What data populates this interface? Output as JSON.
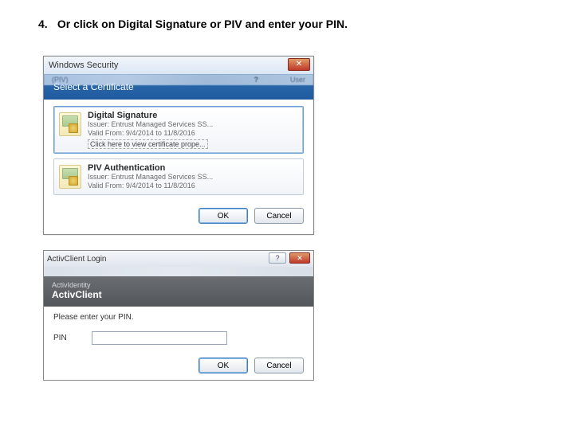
{
  "instruction": {
    "number": "4.",
    "text": "Or click on Digital Signature or PIV and enter your PIN."
  },
  "dlg1": {
    "title": "Windows Security",
    "blurred_tab": "(PIV)",
    "blurred_mark": "?",
    "blurred_user": "User",
    "header": "Select a Certificate",
    "cert1": {
      "name": "Digital Signature",
      "issuer": "Issuer: Entrust Managed Services SS...",
      "valid": "Valid From: 9/4/2014 to 11/8/2016",
      "link": "Click here to view certificate prope..."
    },
    "cert2": {
      "name": "PIV Authentication",
      "issuer": "Issuer: Entrust Managed Services SS...",
      "valid": "Valid From: 9/4/2014 to 11/8/2016"
    },
    "ok": "OK",
    "cancel": "Cancel"
  },
  "dlg2": {
    "title": "ActivClient Login",
    "help": "?",
    "banner_sub": "ActivIdentity",
    "banner_brand": "ActivClient",
    "prompt": "Please enter your PIN.",
    "pin_label": "PIN",
    "ok": "OK",
    "cancel": "Cancel"
  }
}
